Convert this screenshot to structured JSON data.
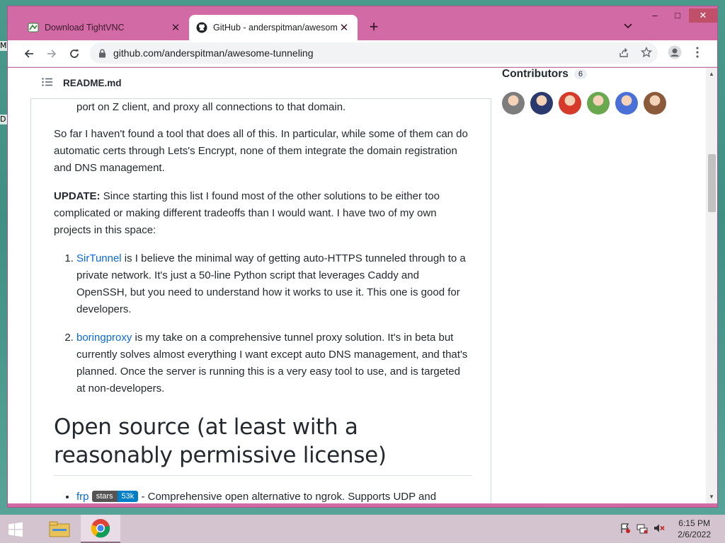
{
  "desktop": {
    "icon_label_1": "M",
    "icon_label_2": "D"
  },
  "browser": {
    "tabs": [
      {
        "title": "Download TightVNC",
        "active": false,
        "icon": "tightvnc-icon"
      },
      {
        "title": "GitHub - anderspitman/awesome-tunneling",
        "active": true,
        "icon": "github-icon"
      }
    ],
    "new_tab": "+",
    "window_controls": {
      "minimize": "–",
      "maximize": "□",
      "close": "✕"
    },
    "url": "github.com/anderspitman/awesome-tunneling"
  },
  "readme": {
    "filename": "README.md",
    "fragment": "port on Z client, and proxy all connections to that domain.",
    "para1": "So far I haven't found a tool that does all of this. In particular, while some of them can do automatic certs through Lets's Encrypt, none of them integrate the domain registration and DNS management.",
    "update_label": "UPDATE:",
    "update_text": " Since starting this list I found most of the other solutions to be either too complicated or making different tradeoffs than I would want. I have two of my own projects in this space:",
    "items": [
      {
        "link": "SirTunnel",
        "text": " is I believe the minimal way of getting auto-HTTPS tunneled through to a private network. It's just a 50-line Python script that leverages Caddy and OpenSSH, but you need to understand how it works to use it. This one is good for developers."
      },
      {
        "link": "boringproxy",
        "text": " is my take on a comprehensive tunnel proxy solution. It's in beta but currently solves almost everything I want except auto DNS management, and that's planned. Once the server is running this is a very easy tool to use, and is targeted at non-developers."
      }
    ],
    "heading": "Open source (at least with a reasonably permissive license)",
    "bullet": {
      "link": "frp",
      "badge_key": "stars",
      "badge_value": "53k",
      "text": " - Comprehensive open alternative to ngrok. Supports UDP and"
    }
  },
  "sidebar": {
    "contributors_label": "Contributors",
    "contributors_count": "6",
    "avatar_colors": [
      "#7d7d7d",
      "#2a3a6e",
      "#d63a2a",
      "#6aa84f",
      "#4a6fd6",
      "#8a5a3a"
    ]
  },
  "taskbar": {
    "time": "6:15 PM",
    "date": "2/6/2022"
  },
  "colors": {
    "window_frame": "#d26aa6",
    "link": "#0969da",
    "text": "#24292f"
  }
}
